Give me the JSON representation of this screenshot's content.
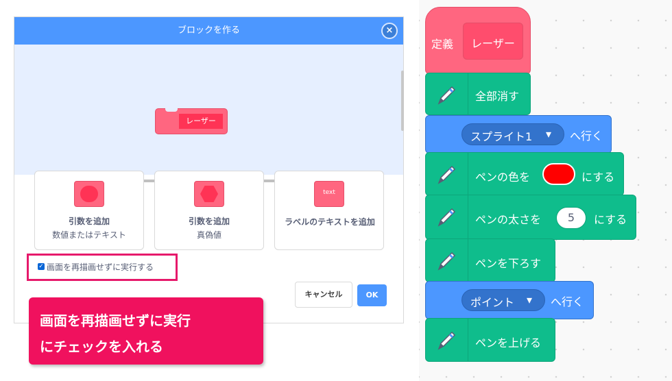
{
  "dialog": {
    "title": "ブロックを作る",
    "close_glyph": "×",
    "preview_block_label": "レーザー",
    "options": [
      {
        "line1": "引数を追加",
        "line2": "数値またはテキスト"
      },
      {
        "line1": "引数を追加",
        "line2": "真偽値"
      },
      {
        "line1": "ラベルのテキストを追加",
        "icon_text": "text"
      }
    ],
    "run_without_refresh": {
      "label": "画面を再描画せずに実行する",
      "checked": true
    },
    "cancel_label": "キャンセル",
    "ok_label": "OK"
  },
  "callout": {
    "line1": "画面を再描画せずに実行",
    "line2": "にチェックを入れる",
    "color": "#f0115e"
  },
  "script": {
    "define": {
      "keyword": "定義",
      "name": "レーザー"
    },
    "blocks": [
      {
        "kind": "pen",
        "text": "全部消す"
      },
      {
        "kind": "motion",
        "dropdown": "スプライト1",
        "suffix": "へ行く"
      },
      {
        "kind": "pen",
        "prefix": "ペンの色を",
        "color": "#ff0000",
        "suffix": "にする"
      },
      {
        "kind": "pen",
        "prefix": "ペンの太さを",
        "value": "5",
        "suffix": "にする"
      },
      {
        "kind": "pen",
        "text": "ペンを下ろす"
      },
      {
        "kind": "motion",
        "dropdown": "ポイント",
        "suffix": "へ行く"
      },
      {
        "kind": "pen",
        "text": "ペンを上げる"
      }
    ],
    "dropdown_arrow": "▾",
    "icons": {
      "pen": "pen-icon",
      "dropdown": "chevron-down-icon"
    }
  },
  "colors": {
    "blue": "#4c97ff",
    "green": "#0fbd8c",
    "pink": "#ff6680",
    "dark_pink": "#ff3355"
  }
}
